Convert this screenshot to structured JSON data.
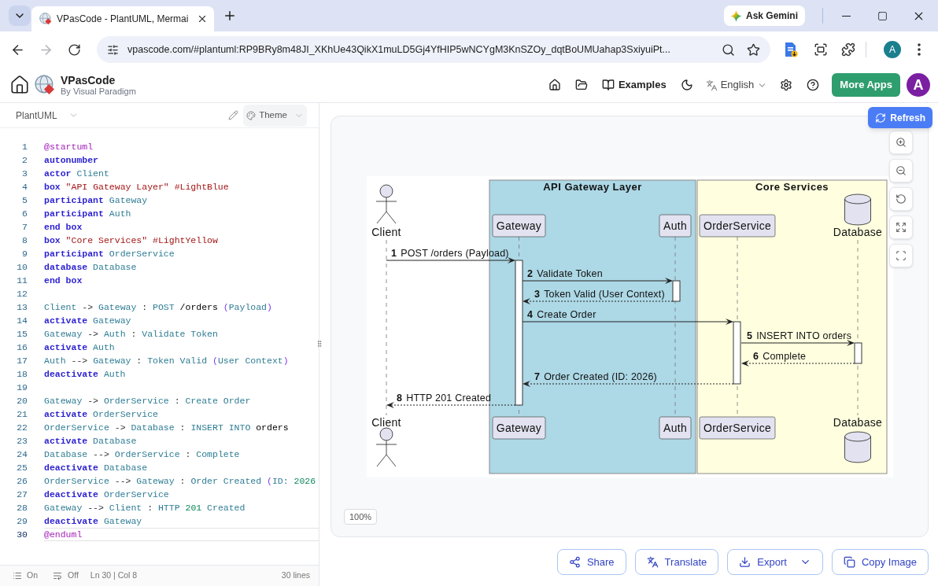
{
  "browser": {
    "tabs": [
      {
        "title": "VPasCode - PlantUML, Mermai",
        "selected": true
      }
    ],
    "gemini_button": "Ask Gemini",
    "nav": [
      {
        "kind": "back",
        "disabled": false
      },
      {
        "kind": "forward",
        "disabled": true
      },
      {
        "kind": "reload",
        "disabled": false
      }
    ],
    "url": "vpascode.com/#plantuml:RP9BRy8m48JI_XKhUe43QikX1muLD5Gj4YfHIP5wNCYgM3KnSZOy_dqtBoUMUahap3SxiyuiPt...",
    "profile": "A"
  },
  "app_header": {
    "brand": "VPasCode",
    "byline": "By Visual Paradigm",
    "examples": "Examples",
    "language": "English",
    "more_apps": "More Apps",
    "avatar": "A"
  },
  "editor": {
    "language": "PlantUML",
    "theme": "Theme",
    "lines": [
      {
        "number": "1",
        "current": false,
        "tokens": [
          {
            "text": "@startuml",
            "kind": "directive"
          }
        ]
      },
      {
        "number": "2",
        "current": false,
        "tokens": [
          {
            "text": "autonumber",
            "kind": "keyword"
          }
        ]
      },
      {
        "number": "3",
        "current": false,
        "tokens": [
          {
            "text": "actor",
            "kind": "keyword"
          },
          {
            "text": " Client",
            "kind": "name"
          }
        ]
      },
      {
        "number": "4",
        "current": false,
        "tokens": [
          {
            "text": "box",
            "kind": "keyword"
          },
          {
            "text": " \"API Gateway Layer\"",
            "kind": "string"
          },
          {
            "text": " #LightBlue",
            "kind": "color"
          }
        ]
      },
      {
        "number": "5",
        "current": false,
        "tokens": [
          {
            "text": "participant",
            "kind": "keyword"
          },
          {
            "text": " Gateway",
            "kind": "name"
          }
        ]
      },
      {
        "number": "6",
        "current": false,
        "tokens": [
          {
            "text": "participant",
            "kind": "keyword"
          },
          {
            "text": " Auth",
            "kind": "name"
          }
        ]
      },
      {
        "number": "7",
        "current": false,
        "tokens": [
          {
            "text": "end box",
            "kind": "keyword"
          }
        ]
      },
      {
        "number": "8",
        "current": false,
        "tokens": [
          {
            "text": "box",
            "kind": "keyword"
          },
          {
            "text": " \"Core Services\"",
            "kind": "string"
          },
          {
            "text": " #LightYellow",
            "kind": "color"
          }
        ]
      },
      {
        "number": "9",
        "current": false,
        "tokens": [
          {
            "text": "participant",
            "kind": "keyword"
          },
          {
            "text": " OrderService",
            "kind": "name"
          }
        ]
      },
      {
        "number": "10",
        "current": false,
        "tokens": [
          {
            "text": "database",
            "kind": "keyword"
          },
          {
            "text": " Database",
            "kind": "name"
          }
        ]
      },
      {
        "number": "11",
        "current": false,
        "tokens": [
          {
            "text": "end box",
            "kind": "keyword"
          }
        ]
      },
      {
        "number": "12",
        "current": false
      },
      {
        "number": "13",
        "current": false,
        "tokens": [
          {
            "text": "Client",
            "kind": "name"
          },
          {
            "text": " -> ",
            "kind": "operator"
          },
          {
            "text": "Gateway",
            "kind": "name"
          },
          {
            "text": " : ",
            "kind": "operator"
          },
          {
            "text": "POST",
            "kind": "name"
          },
          {
            "text": " /orders ",
            "kind": "plain"
          },
          {
            "text": "(",
            "kind": "paren"
          },
          {
            "text": "Payload",
            "kind": "name"
          },
          {
            "text": ")",
            "kind": "paren"
          }
        ]
      },
      {
        "number": "14",
        "current": false,
        "tokens": [
          {
            "text": "activate",
            "kind": "keyword"
          },
          {
            "text": " Gateway",
            "kind": "name"
          }
        ]
      },
      {
        "number": "15",
        "current": false,
        "tokens": [
          {
            "text": "Gateway",
            "kind": "name"
          },
          {
            "text": " -> ",
            "kind": "operator"
          },
          {
            "text": "Auth",
            "kind": "name"
          },
          {
            "text": " : ",
            "kind": "operator"
          },
          {
            "text": "Validate Token",
            "kind": "name"
          }
        ]
      },
      {
        "number": "16",
        "current": false,
        "tokens": [
          {
            "text": "activate",
            "kind": "keyword"
          },
          {
            "text": " Auth",
            "kind": "name"
          }
        ]
      },
      {
        "number": "17",
        "current": false,
        "tokens": [
          {
            "text": "Auth",
            "kind": "name"
          },
          {
            "text": " --> ",
            "kind": "operator"
          },
          {
            "text": "Gateway",
            "kind": "name"
          },
          {
            "text": " : ",
            "kind": "operator"
          },
          {
            "text": "Token Valid ",
            "kind": "name"
          },
          {
            "text": "(",
            "kind": "paren"
          },
          {
            "text": "User Context",
            "kind": "name"
          },
          {
            "text": ")",
            "kind": "paren"
          }
        ]
      },
      {
        "number": "18",
        "current": false,
        "tokens": [
          {
            "text": "deactivate",
            "kind": "keyword"
          },
          {
            "text": " Auth",
            "kind": "name"
          }
        ]
      },
      {
        "number": "19",
        "current": false
      },
      {
        "number": "20",
        "current": false,
        "tokens": [
          {
            "text": "Gateway",
            "kind": "name"
          },
          {
            "text": " -> ",
            "kind": "operator"
          },
          {
            "text": "OrderService",
            "kind": "name"
          },
          {
            "text": " : ",
            "kind": "operator"
          },
          {
            "text": "Create Order",
            "kind": "name"
          }
        ]
      },
      {
        "number": "21",
        "current": false,
        "tokens": [
          {
            "text": "activate",
            "kind": "keyword"
          },
          {
            "text": " OrderService",
            "kind": "name"
          }
        ]
      },
      {
        "number": "22",
        "current": false,
        "tokens": [
          {
            "text": "OrderService",
            "kind": "name"
          },
          {
            "text": " -> ",
            "kind": "operator"
          },
          {
            "text": "Database",
            "kind": "name"
          },
          {
            "text": " : ",
            "kind": "operator"
          },
          {
            "text": "INSERT INTO ",
            "kind": "name"
          },
          {
            "text": "orders",
            "kind": "plain"
          }
        ]
      },
      {
        "number": "23",
        "current": false,
        "tokens": [
          {
            "text": "activate",
            "kind": "keyword"
          },
          {
            "text": " Database",
            "kind": "name"
          }
        ]
      },
      {
        "number": "24",
        "current": false,
        "tokens": [
          {
            "text": "Database",
            "kind": "name"
          },
          {
            "text": " --> ",
            "kind": "operator"
          },
          {
            "text": "OrderService",
            "kind": "name"
          },
          {
            "text": " : ",
            "kind": "operator"
          },
          {
            "text": "Complete",
            "kind": "name"
          }
        ]
      },
      {
        "number": "25",
        "current": false,
        "tokens": [
          {
            "text": "deactivate",
            "kind": "keyword"
          },
          {
            "text": " Database",
            "kind": "name"
          }
        ]
      },
      {
        "number": "26",
        "current": false,
        "tokens": [
          {
            "text": "OrderService",
            "kind": "name"
          },
          {
            "text": " --> ",
            "kind": "operator"
          },
          {
            "text": "Gateway",
            "kind": "name"
          },
          {
            "text": " : ",
            "kind": "operator"
          },
          {
            "text": "Order Created ",
            "kind": "name"
          },
          {
            "text": "(",
            "kind": "paren"
          },
          {
            "text": "ID: ",
            "kind": "name"
          },
          {
            "text": "2026",
            "kind": "number"
          }
        ]
      },
      {
        "number": "27",
        "current": false,
        "tokens": [
          {
            "text": "deactivate",
            "kind": "keyword"
          },
          {
            "text": " OrderService",
            "kind": "name"
          }
        ]
      },
      {
        "number": "28",
        "current": false,
        "tokens": [
          {
            "text": "Gateway",
            "kind": "name"
          },
          {
            "text": " --> ",
            "kind": "operator"
          },
          {
            "text": "Client",
            "kind": "name"
          },
          {
            "text": " : ",
            "kind": "operator"
          },
          {
            "text": "HTTP ",
            "kind": "name"
          },
          {
            "text": "201",
            "kind": "number"
          },
          {
            "text": " Created",
            "kind": "name"
          }
        ]
      },
      {
        "number": "29",
        "current": false,
        "tokens": [
          {
            "text": "deactivate",
            "kind": "keyword"
          },
          {
            "text": " Gateway",
            "kind": "name"
          }
        ]
      },
      {
        "number": "30",
        "current": true,
        "tokens": [
          {
            "text": "@enduml",
            "kind": "directive"
          }
        ]
      }
    ],
    "status": {
      "toggles": [
        {
          "kind": "line_numbers",
          "label": "On"
        },
        {
          "kind": "wrap",
          "label": "Off"
        }
      ],
      "position": "Ln 30 | Col 8",
      "line_count": "30 lines"
    }
  },
  "preview": {
    "refresh": "Refresh",
    "zoom": "100%",
    "diagram": {
      "groups": [
        {
          "title": "API Gateway Layer",
          "color": "#add8e6"
        },
        {
          "title": "Core Services",
          "color": "#ffffe0"
        }
      ],
      "participants": [
        {
          "kind": "actor",
          "top": "Client",
          "bottom": "Client"
        },
        {
          "kind": "participant",
          "top": "Gateway",
          "bottom": "Gateway"
        },
        {
          "kind": "participant",
          "top": "Auth",
          "bottom": "Auth"
        },
        {
          "kind": "participant",
          "top": "OrderService",
          "bottom": "OrderService"
        },
        {
          "kind": "database",
          "top": "Database",
          "bottom": "Database"
        }
      ],
      "messages": [
        {
          "number": "1",
          "label": "POST /orders (Payload)",
          "kind": "call"
        },
        {
          "number": "2",
          "label": "Validate Token",
          "kind": "call"
        },
        {
          "number": "3",
          "label": "Token Valid (User Context)",
          "kind": "return"
        },
        {
          "number": "4",
          "label": "Create Order",
          "kind": "call"
        },
        {
          "number": "5",
          "label": "INSERT INTO orders",
          "kind": "call"
        },
        {
          "number": "6",
          "label": "Complete",
          "kind": "return"
        },
        {
          "number": "7",
          "label": "Order Created (ID: 2026)",
          "kind": "return"
        },
        {
          "number": "8",
          "label": "HTTP 201 Created",
          "kind": "return"
        }
      ]
    }
  },
  "actions": [
    {
      "kind": "share",
      "label": "Share"
    },
    {
      "kind": "translate",
      "label": "Translate"
    },
    {
      "kind": "export",
      "label": "Export"
    },
    {
      "kind": "copy",
      "label": "Copy Image"
    }
  ]
}
